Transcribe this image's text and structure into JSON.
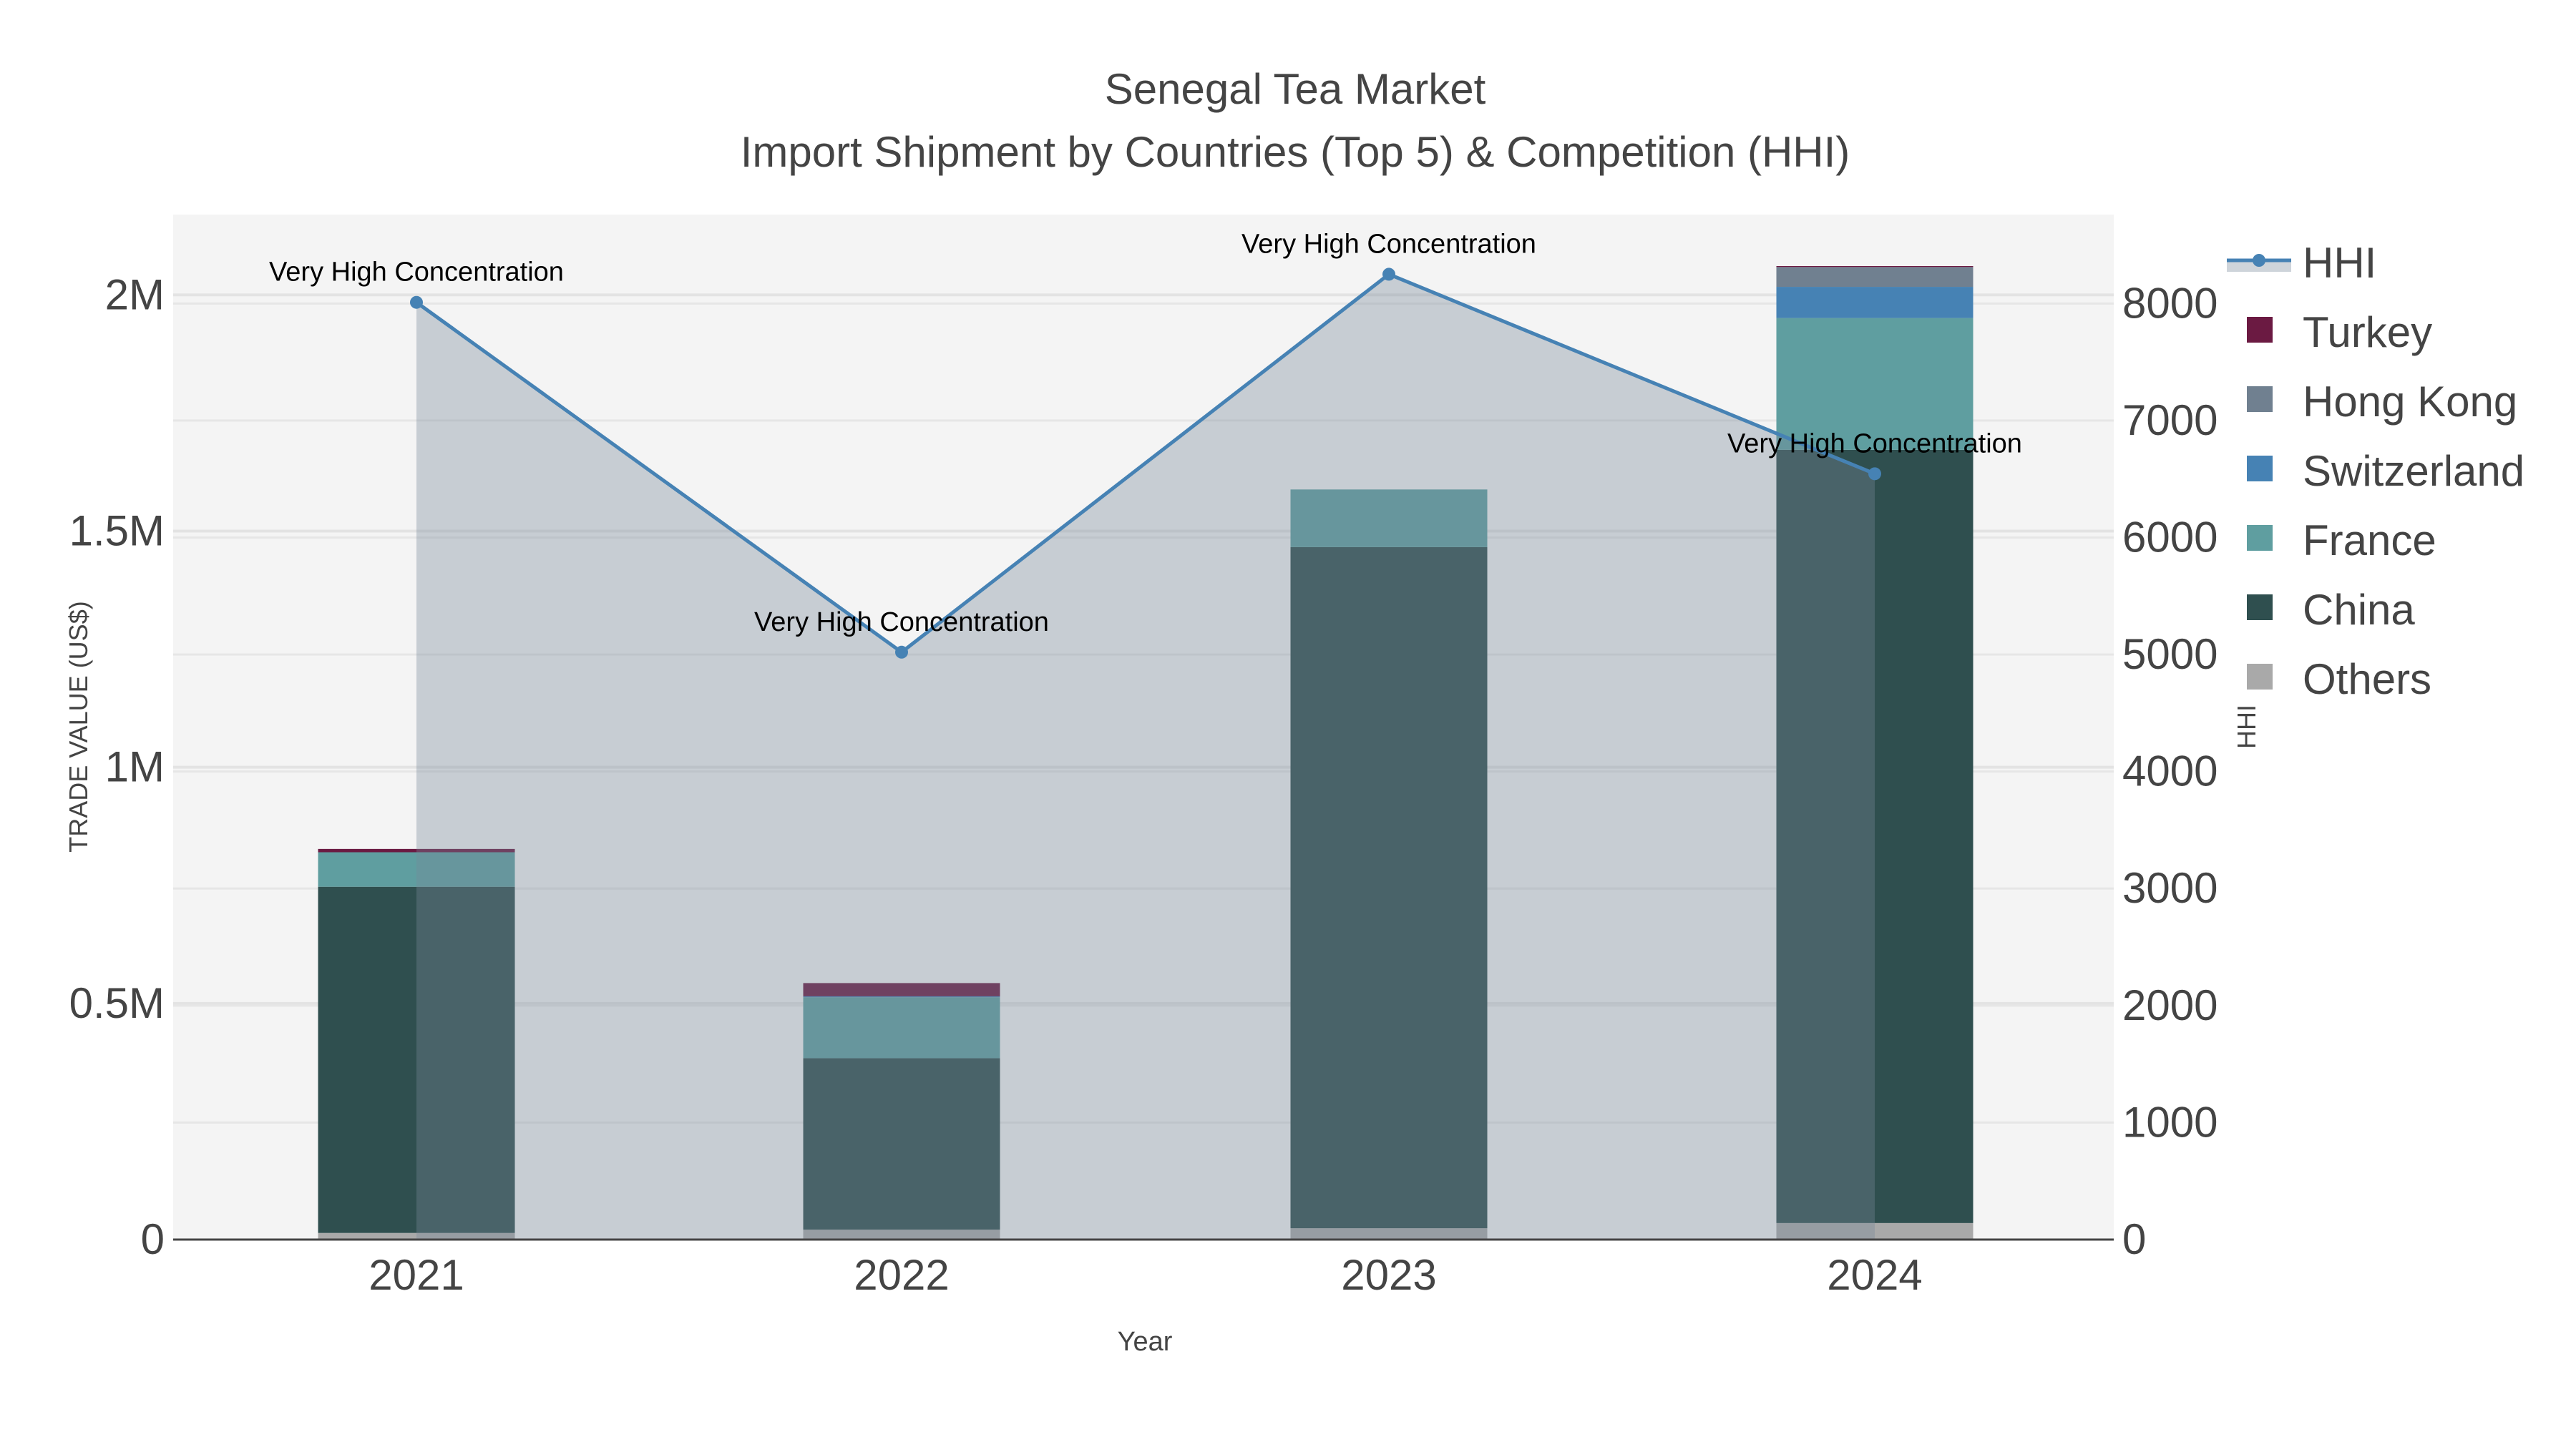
{
  "chart_data": {
    "type": "bar",
    "title": "Senegal Tea Market",
    "subtitle": "Import Shipment by Countries (Top 5) & Competition (HHI)",
    "xlabel": "Year",
    "ylabel": "TRADE VALUE (US$)",
    "y2label": "HHI",
    "categories": [
      "2021",
      "2022",
      "2023",
      "2024"
    ],
    "ylim": [
      0,
      2170000
    ],
    "y2lim": [
      0,
      8760
    ],
    "yticks": [
      {
        "v": 0,
        "label": "0"
      },
      {
        "v": 500000,
        "label": "0.5M"
      },
      {
        "v": 1000000,
        "label": "1M"
      },
      {
        "v": 1500000,
        "label": "1.5M"
      },
      {
        "v": 2000000,
        "label": "2M"
      }
    ],
    "y2ticks": [
      0,
      1000,
      2000,
      3000,
      4000,
      5000,
      6000,
      7000,
      8000
    ],
    "grid": true,
    "legend_position": "right",
    "series": [
      {
        "name": "Others",
        "color": "#a9a9a9",
        "values": [
          14000,
          21000,
          24000,
          35000
        ]
      },
      {
        "name": "China",
        "color": "#2f4f4f",
        "values": [
          733000,
          363000,
          1442000,
          1637000
        ]
      },
      {
        "name": "France",
        "color": "#5f9ea0",
        "values": [
          73000,
          129000,
          122000,
          279000
        ]
      },
      {
        "name": "Switzerland",
        "color": "#4682b4",
        "values": [
          0,
          2000,
          0,
          66000
        ]
      },
      {
        "name": "Hong Kong",
        "color": "#708090",
        "values": [
          0,
          0,
          0,
          42000
        ]
      },
      {
        "name": "Turkey",
        "color": "#6b1a42",
        "values": [
          7000,
          28000,
          0,
          2000
        ]
      }
    ],
    "line": {
      "name": "HHI",
      "color": "#4682b4",
      "values": [
        8010,
        5020,
        8250,
        6545
      ]
    },
    "annotations": [
      "Very High Concentration",
      "Very High Concentration",
      "Very High Concentration",
      "Very High Concentration"
    ],
    "legend_order": [
      "HHI",
      "Turkey",
      "Hong Kong",
      "Switzerland",
      "France",
      "China",
      "Others"
    ]
  }
}
